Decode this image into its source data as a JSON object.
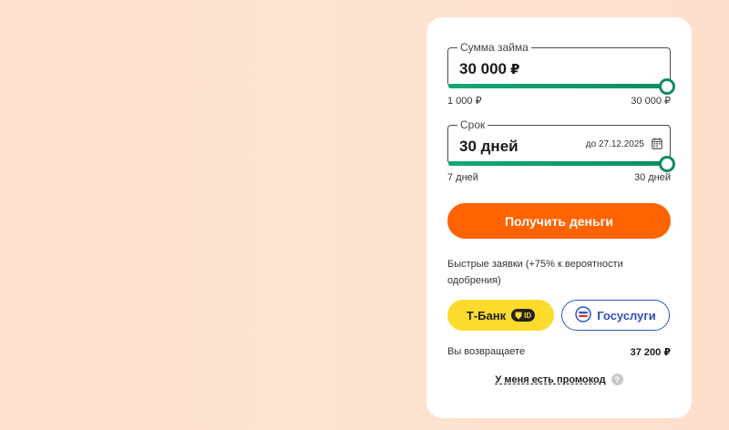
{
  "loan_amount": {
    "label": "Сумма займа",
    "value": "30 000",
    "currency": "₽",
    "min_label": "1 000 ₽",
    "max_label": "30 000 ₽",
    "min": 1000,
    "max": 30000,
    "current": 30000
  },
  "loan_term": {
    "label": "Срок",
    "value": "30 дней",
    "until_note": "до 27.12.2025",
    "min_label": "7 дней",
    "max_label": "30 дней",
    "min": 7,
    "max": 30,
    "current": 30
  },
  "cta_label": "Получить деньги",
  "fast_apply_text": "Быстрые заявки (+75% к вероятности одобрения)",
  "tbank_label": "Т-Банк",
  "tbank_badge": "ID",
  "gosuslugi_label": "Госуслуги",
  "return_label": "Вы возвращаете",
  "return_value": "37 200 ₽",
  "promo_label": "У меня есть промокод",
  "help_glyph": "?",
  "colors": {
    "accent": "#ff6200",
    "slider": "#0d9d6c",
    "tbank": "#fddb2d",
    "gosuslugi": "#2d55c4",
    "background": "#fee0cc"
  },
  "icons": [
    "calendar-icon",
    "tbank-id-icon",
    "gosuslugi-logo-icon",
    "help-icon"
  ]
}
